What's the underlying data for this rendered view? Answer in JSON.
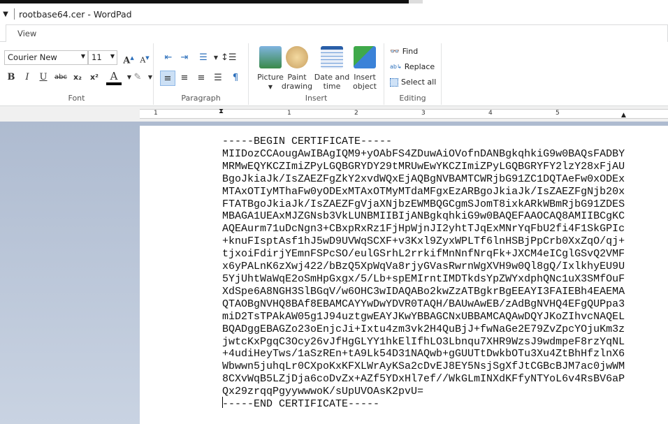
{
  "window": {
    "title": "rootbase64.cer - WordPad",
    "qa_icon": "dropdown-arrow-icon"
  },
  "tabs": [
    {
      "label": "View"
    }
  ],
  "ribbon": {
    "font": {
      "label": "Font",
      "family": "Courier New",
      "size": "11"
    },
    "paragraph": {
      "label": "Paragraph"
    },
    "insert": {
      "label": "Insert",
      "picture": "Picture",
      "paint_drawing": "Paint drawing",
      "date_time": "Date and time",
      "insert_object": "Insert object"
    },
    "editing": {
      "label": "Editing",
      "find": "Find",
      "replace": "Replace",
      "select_all": "Select all"
    }
  },
  "ruler": {
    "numbers": [
      "1",
      "1",
      "2",
      "3",
      "4",
      "5"
    ]
  },
  "document": {
    "lines": [
      "-----BEGIN CERTIFICATE-----",
      "MIIDozCCAougAwIBAgIQM9+yOAbFS4ZDuwAiOVofnDANBgkqhkiG9w0BAQsFADBY",
      "MRMwEQYKCZImiZPyLGQBGRYDY29tMRUwEwYKCZImiZPyLGQBGRYFY2lzY28xFjAU",
      "BgoJkiaJk/IsZAEZFgZkY2xvdWQxEjAQBgNVBAMTCWRjbG91ZC1DQTAeFw0xODEx",
      "MTAxOTIyMThaFw0yODExMTAxOTMyMTdaMFgxEzARBgoJkiaJk/IsZAEZFgNjb20x",
      "FTATBgoJkiaJk/IsZAEZFgVjaXNjbzEWMBQGCgmSJomT8ixkARkWBmRjbG91ZDES",
      "MBAGA1UEAxMJZGNsb3VkLUNBMIIBIjANBgkqhkiG9w0BAQEFAAOCAQ8AMIIBCgKC",
      "AQEAurm71uDcNgn3+CBxpRxRz1FjHpWjnJI2yhtTJqExMNrYqFbU2fi4F1SkGPIc",
      "+knuFIsptAsf1hJ5wD9UVWqSCXF+v3Kxl9ZyxWPLTf6lnHSBjPpCrb0XxZqO/qj+",
      "tjxoiFdirjYEmnFSPcSO/eulGSrhL2rrkifMnNnfNrqFk+JXCM4eICglGSvQ2VMF",
      "x6yPALnK6zXwj422/bBzQ5XpWqVa8rjyGVasRwrnWgXVH9w0Ql8gQ/IxlkhyEU9U",
      "5YjUhtWaWqE2oSmHpGxgx/5/Lb+spEMIrntIMDTkdsYpZWYxdphQNc1uX3SMfOuF",
      "XdSpe6A8NGH3SlBGqV/w6OHC3wIDAQABo2kwZzATBgkrBgEEAYI3FAIEBh4EAEMA",
      "QTAOBgNVHQ8BAf8EBAMCAYYwDwYDVR0TAQH/BAUwAwEB/zAdBgNVHQ4EFgQUPpa3",
      "miD2TsTPAkAW05g1J94uztgwEAYJKwYBBAGCNxUBBAMCAQAwDQYJKoZIhvcNAQEL",
      "BQADggEBAGZo23oEnjcJi+Ixtu4zm3vk2H4QuBjJ+fwNaGe2E79ZvZpcYOjuKm3z",
      "jwtcKxPgqC3Ocy26vJfHgGLYY1hkElIfhLO3Lbnqu7XHR9WzsJ9wdmpeF8rzYqNL",
      "+4udiHeyTws/1aSzREn+tA9Lk54D31NAQwb+gGUUTtDwkbOTu3Xu4ZtBhHfzlnX6",
      "Wbwwn5juhqLr0CXpoKxKFXLWrAyKSa2cDvEJ8EY5NsjSgXfJtCGBcBJM7ac0jwWM",
      "8CXvWqB5LZjDja6coDvZx+AZf5YDxHl7ef//WkGLmINXdKFfyNTYoL6v4RsBV6aP",
      "Qx29zrqqPgyywwwoK/sUpUVOAsK2pvU=",
      "-----END CERTIFICATE-----"
    ]
  }
}
